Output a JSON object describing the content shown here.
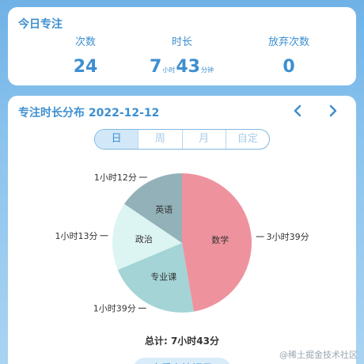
{
  "today": {
    "title": "今日专注",
    "stats": [
      {
        "label": "次数",
        "value": "24"
      },
      {
        "label": "时长",
        "hours": "7",
        "hours_unit": "小时",
        "minutes": "43",
        "minutes_unit": "分钟"
      },
      {
        "label": "放弃次数",
        "value": "0"
      }
    ]
  },
  "distribution": {
    "title": "专注时长分布 2022-12-12",
    "tabs": [
      {
        "label": "日",
        "active": true
      },
      {
        "label": "周",
        "active": false
      },
      {
        "label": "月",
        "active": false
      },
      {
        "label": "自定",
        "active": false
      }
    ],
    "total": "总计: 7小时43分",
    "bottom_button": "查看专注记录"
  },
  "chart_data": {
    "type": "pie",
    "slices": [
      {
        "label": "数学",
        "value": 219,
        "display": "3小时39分",
        "color": "#ee939e"
      },
      {
        "label": "专业课",
        "value": 99,
        "display": "1小时39分",
        "color": "#a4d4d6"
      },
      {
        "label": "政治",
        "value": 73,
        "display": "1小时13分",
        "color": "#dcf4f2"
      },
      {
        "label": "英语",
        "value": 72,
        "display": "1小时12分",
        "color": "#93b1b8"
      }
    ]
  },
  "watermark": "@稀土掘金技术社区"
}
